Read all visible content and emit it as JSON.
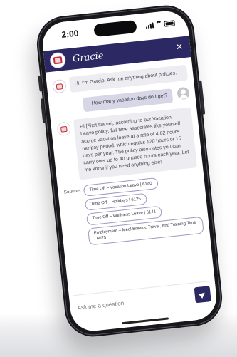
{
  "status": {
    "time": "2:00"
  },
  "header": {
    "title": "Gracie"
  },
  "messages": {
    "bot_intro": "Hi, I'm Gracie. Ask me anything about policies.",
    "user_question": "How many vacation days do I get?",
    "bot_answer": "Hi [First Name], according to our Vacation Leave policy, full-time associates like yourself accrue vacation leave at a rate of 4.62 hours per pay period, which equals 120 hours or 15 days per year. The policy also notes you can carry over up to 40 unused hours each year. Let me know if you need anything else!"
  },
  "sources": {
    "label": "Sources",
    "items": [
      "Time Off – Vacation Leave | 6140",
      "Time Off – Holidays | 6125",
      "Time Off – Wellness Leave | 6141",
      "Employment – Meal Breaks, Travel, And Training Time | 6075"
    ]
  },
  "input": {
    "placeholder": "Ask me a question."
  },
  "colors": {
    "brand": "#2b2863",
    "bubble_bot": "#ececf1",
    "bubble_user": "#d7d6e6"
  },
  "icons": [
    "gracie-logo-icon",
    "close-icon",
    "user-avatar-icon",
    "send-icon",
    "signal-icon",
    "wifi-icon",
    "battery-icon"
  ]
}
